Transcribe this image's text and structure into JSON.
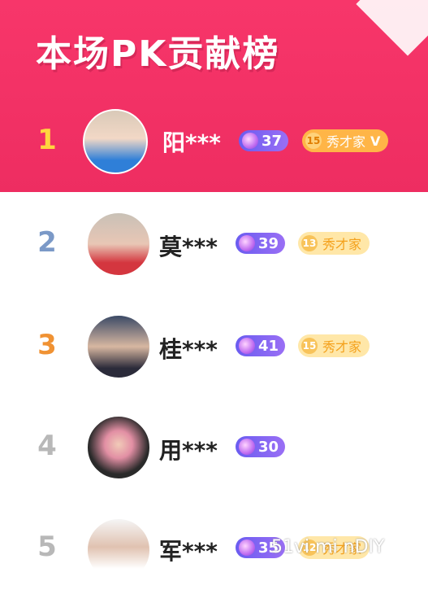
{
  "header": {
    "title": "本场PK贡献榜"
  },
  "rows": [
    {
      "rank": "1",
      "name": "阳***",
      "level": "37",
      "fans_level": "15",
      "fans_title": "秀才家",
      "check": "V",
      "rank_color": "#ffd53f"
    },
    {
      "rank": "2",
      "name": "莫***",
      "level": "39",
      "fans_level": "13",
      "fans_title": "秀才家",
      "rank_color": "#7b99c7"
    },
    {
      "rank": "3",
      "name": "桂***",
      "level": "41",
      "fans_level": "15",
      "fans_title": "秀才家",
      "rank_color": "#f09233"
    },
    {
      "rank": "4",
      "name": "用***",
      "level": "30",
      "rank_color": "#b8b8b8"
    },
    {
      "rank": "5",
      "name": "军***",
      "level": "35",
      "fans_level": "12",
      "fans_title": "秀才家",
      "rank_color": "#b8b8b8"
    }
  ],
  "watermark": "51vi mi nDIY"
}
